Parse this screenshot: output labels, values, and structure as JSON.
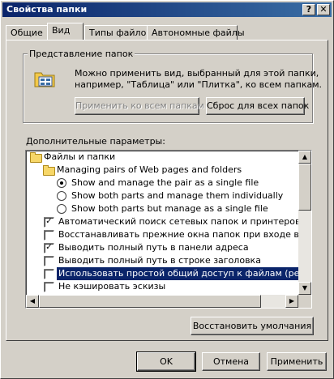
{
  "window": {
    "title": "Свойства папки",
    "help_btn": "?",
    "close_btn": "✕"
  },
  "tabs": [
    {
      "label": "Общие"
    },
    {
      "label": "Вид"
    },
    {
      "label": "Типы файлов"
    },
    {
      "label": "Автономные файлы"
    }
  ],
  "folder_view": {
    "legend": "Представление папок",
    "description": "Можно применить вид, выбранный для этой папки, например, \"Таблица\" или \"Плитка\", ко всем папкам.",
    "desc_line1": "Можно применить вид, выбранный для этой папки,",
    "desc_line2": "например, \"Таблица\" или \"Плитка\", ко всем папкам.",
    "apply_all_label": "Применить ко всем папкам",
    "reset_all_label": "Сброс для всех папок"
  },
  "advanced": {
    "label": "Дополнительные параметры:",
    "items": [
      {
        "type": "folder",
        "label": "Файлы и папки"
      },
      {
        "type": "folder",
        "label": "Managing pairs of Web pages and folders"
      },
      {
        "type": "radio",
        "checked": true,
        "label": "Show and manage the pair as a single file"
      },
      {
        "type": "radio",
        "checked": false,
        "label": "Show both parts and manage them individually"
      },
      {
        "type": "radio",
        "checked": false,
        "label": "Show both parts but manage as a single file"
      },
      {
        "type": "checkbox",
        "checked": true,
        "label": "Автоматический поиск сетевых папок и принтеров"
      },
      {
        "type": "checkbox",
        "checked": false,
        "label": "Восстанавливать прежние окна папок при входе в систем"
      },
      {
        "type": "checkbox",
        "checked": true,
        "label": "Выводить полный путь в панели адреса"
      },
      {
        "type": "checkbox",
        "checked": false,
        "label": "Выводить полный путь в строке заголовка"
      },
      {
        "type": "checkbox",
        "checked": false,
        "label": "Использовать простой общий доступ к файлам (рекомен"
      },
      {
        "type": "checkbox",
        "checked": false,
        "label": "Не кэшировать эскизы"
      }
    ]
  },
  "restore_defaults_label": "Восстановить умолчания",
  "footer": {
    "ok_label": "OK",
    "cancel_label": "Отмена",
    "apply_label": "Применить"
  }
}
